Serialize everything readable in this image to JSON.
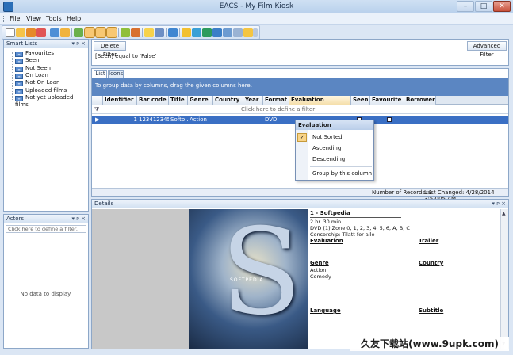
{
  "window": {
    "title": "EACS - My Film Kiosk"
  },
  "menu": [
    "File",
    "View",
    "Tools",
    "Help"
  ],
  "toolbar": {
    "buttons": 26
  },
  "smart_lists": {
    "title": "Smart Lists",
    "pin": "↓ x ×",
    "items": [
      "Favourites",
      "Seen",
      "Not Seen",
      "On Loan",
      "Not On Loan",
      "Uploaded films",
      "Not yet uploaded films"
    ]
  },
  "actors": {
    "title": "Actors",
    "filter_placeholder": "Click here to define a filter.",
    "empty": "No data to display."
  },
  "filter": {
    "delete_label": "Delete Filter",
    "advanced_label": "Advanced Filter",
    "expression": "[Seen] equal to 'False'"
  },
  "tabs": [
    "List",
    "Icons"
  ],
  "group_hint": "To group data by columns, drag the given columns here.",
  "grid": {
    "columns": [
      "Identifier",
      "Bar code",
      "Title",
      "Genre",
      "Country",
      "Year",
      "Format",
      "Evaluation",
      "Seen",
      "Favourite",
      "Borrower"
    ],
    "filter_row": "Click here to define a filter",
    "row": {
      "identifier": "1",
      "barcode": "123412345",
      "title": "Softp...",
      "genre": "Action",
      "country": "",
      "year": "",
      "format": "DVD"
    }
  },
  "column_menu": {
    "header": "Evaluation",
    "items": [
      "Not Sorted",
      "Ascending",
      "Descending",
      "Group by this column"
    ],
    "checked": "Not Sorted"
  },
  "status": {
    "records": "Number of Records: 1",
    "changed": "Last Changed: 4/28/2014 3:53:05 AM"
  },
  "details": {
    "title": "Details",
    "heading": "1 - Softpedia",
    "duration": "2 hr. 30 min.",
    "format": "DVD (1) Zone 0, 1, 2, 3, 4, 5, 6, A, B, C",
    "censorship": "Censorship: Tilatt for alle",
    "evaluation_label": "Evaluation",
    "trailer_label": "Trailer",
    "genre_label": "Genre",
    "country_label": "Country",
    "genres": [
      "Action",
      "Comedy"
    ],
    "language_label": "Language",
    "subtitle_label": "Subtitle",
    "poster_text": "SOFTPEDIA"
  },
  "watermark": "久友下载站(www.9upk.com)"
}
